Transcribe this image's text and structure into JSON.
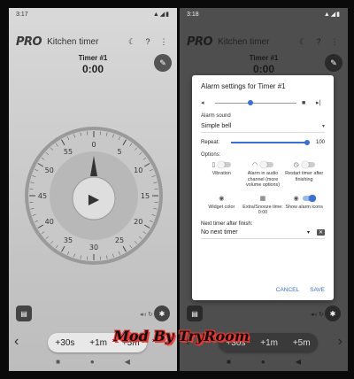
{
  "left": {
    "status_time": "3:17",
    "status_icons": "▲◢▮",
    "logo": "PRO",
    "title": "Kitchen timer",
    "moon_icon": "☾",
    "help_icon": "?",
    "more_icon": "⋮",
    "timer_label": "Timer #1",
    "timer_time": "0:00",
    "edit_icon": "✎",
    "dial_numbers": [
      "0",
      "5",
      "10",
      "15",
      "20",
      "25",
      "30",
      "35",
      "40",
      "45",
      "50",
      "55"
    ],
    "play_icon": "▶",
    "chip_icon": "▤",
    "settings_icon": "✱",
    "mini_icons": "◂◃ ↻",
    "chev_left": "‹",
    "chev_right": "›",
    "quick_buttons": [
      "+30s",
      "+1m",
      "+5m"
    ],
    "nav": [
      "■",
      "●",
      "◀"
    ]
  },
  "right": {
    "status_time": "3:18",
    "status_icons": "▲◢▮",
    "logo": "PRO",
    "title": "Kitchen timer",
    "moon_icon": "☾",
    "help_icon": "?",
    "more_icon": "⋮",
    "timer_label": "Timer #1",
    "timer_time": "0:00",
    "edit_icon": "✎",
    "chip_icon": "▤",
    "settings_icon": "✱",
    "mini_icons": "◂◃ ↻",
    "chev_left": "‹",
    "chev_right": "›",
    "quick_buttons": [
      "+30s",
      "+1m",
      "+5m"
    ],
    "nav": [
      "■",
      "●",
      "◀"
    ]
  },
  "dialog": {
    "title": "Alarm settings for Timer #1",
    "volume_icon": "◂",
    "stop_icon": "■",
    "next_icon": "▸|",
    "volume_level": 0.4,
    "alarm_sound_label": "Alarm sound",
    "alarm_sound_value": "Simple bell",
    "dropdown_icon": "▾",
    "repeat_label": "Repeat:",
    "repeat_value": "100",
    "options_label": "Options:",
    "options": [
      {
        "icon": "▯",
        "label": "Vibration",
        "on": false
      },
      {
        "icon": "◠",
        "label": "Alarm in audio channel (more volume options)",
        "on": false
      },
      {
        "icon": "◷",
        "label": "Restart timer after finishing",
        "on": false
      },
      {
        "icon": "◉",
        "label": "Widget color",
        "on": null
      },
      {
        "icon": "▦",
        "label": "Extra/Snooze time: 0:00",
        "on": null
      },
      {
        "icon": "◉",
        "label": "Show alarm icons",
        "on": true
      }
    ],
    "after_label": "Next timer after finish:",
    "after_value": "No next timer",
    "clear_icon": "✕",
    "cancel": "CANCEL",
    "save": "SAVE"
  },
  "watermark": "Mod By TryRoom"
}
